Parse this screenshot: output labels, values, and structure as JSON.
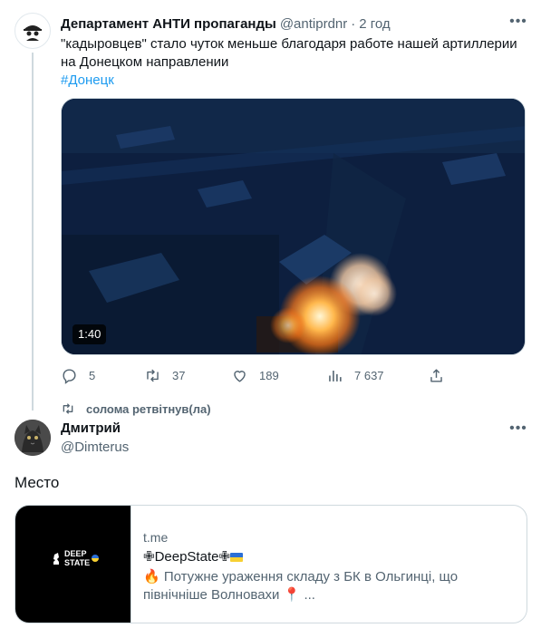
{
  "tweet1": {
    "name": "Департамент АНТИ пропаганды",
    "handle": "@antiprdnr",
    "separator": "·",
    "time": "2 год",
    "text": "\"кадыровцев\" стало чуток меньше благодаря работе нашей артиллерии на Донецком направлении",
    "hashtag": "#Донецк",
    "video_duration": "1:40",
    "actions": {
      "replies": "5",
      "retweets": "37",
      "likes": "189",
      "views": "7 637"
    }
  },
  "retweet_banner": "солома ретвітнув(ла)",
  "tweet2": {
    "name": "Дмитрий",
    "handle": "@Dimterus",
    "text": "Место"
  },
  "card": {
    "domain": "t.me",
    "title": "✙DeepState✙",
    "description": "🔥 Потужне ураження складу з БК в Ольгинці, що північніше Волновахи 📍 ...",
    "logo_line1": "DEEP",
    "logo_line2": "STATE"
  },
  "icons": {
    "more": "more-dots-icon",
    "reply": "reply-icon",
    "retweet": "retweet-icon",
    "like": "heart-icon",
    "views": "views-chart-icon",
    "share": "share-icon"
  },
  "colors": {
    "link": "#1d9bf0",
    "secondary_text": "#536471",
    "primary_text": "#0f1419"
  }
}
